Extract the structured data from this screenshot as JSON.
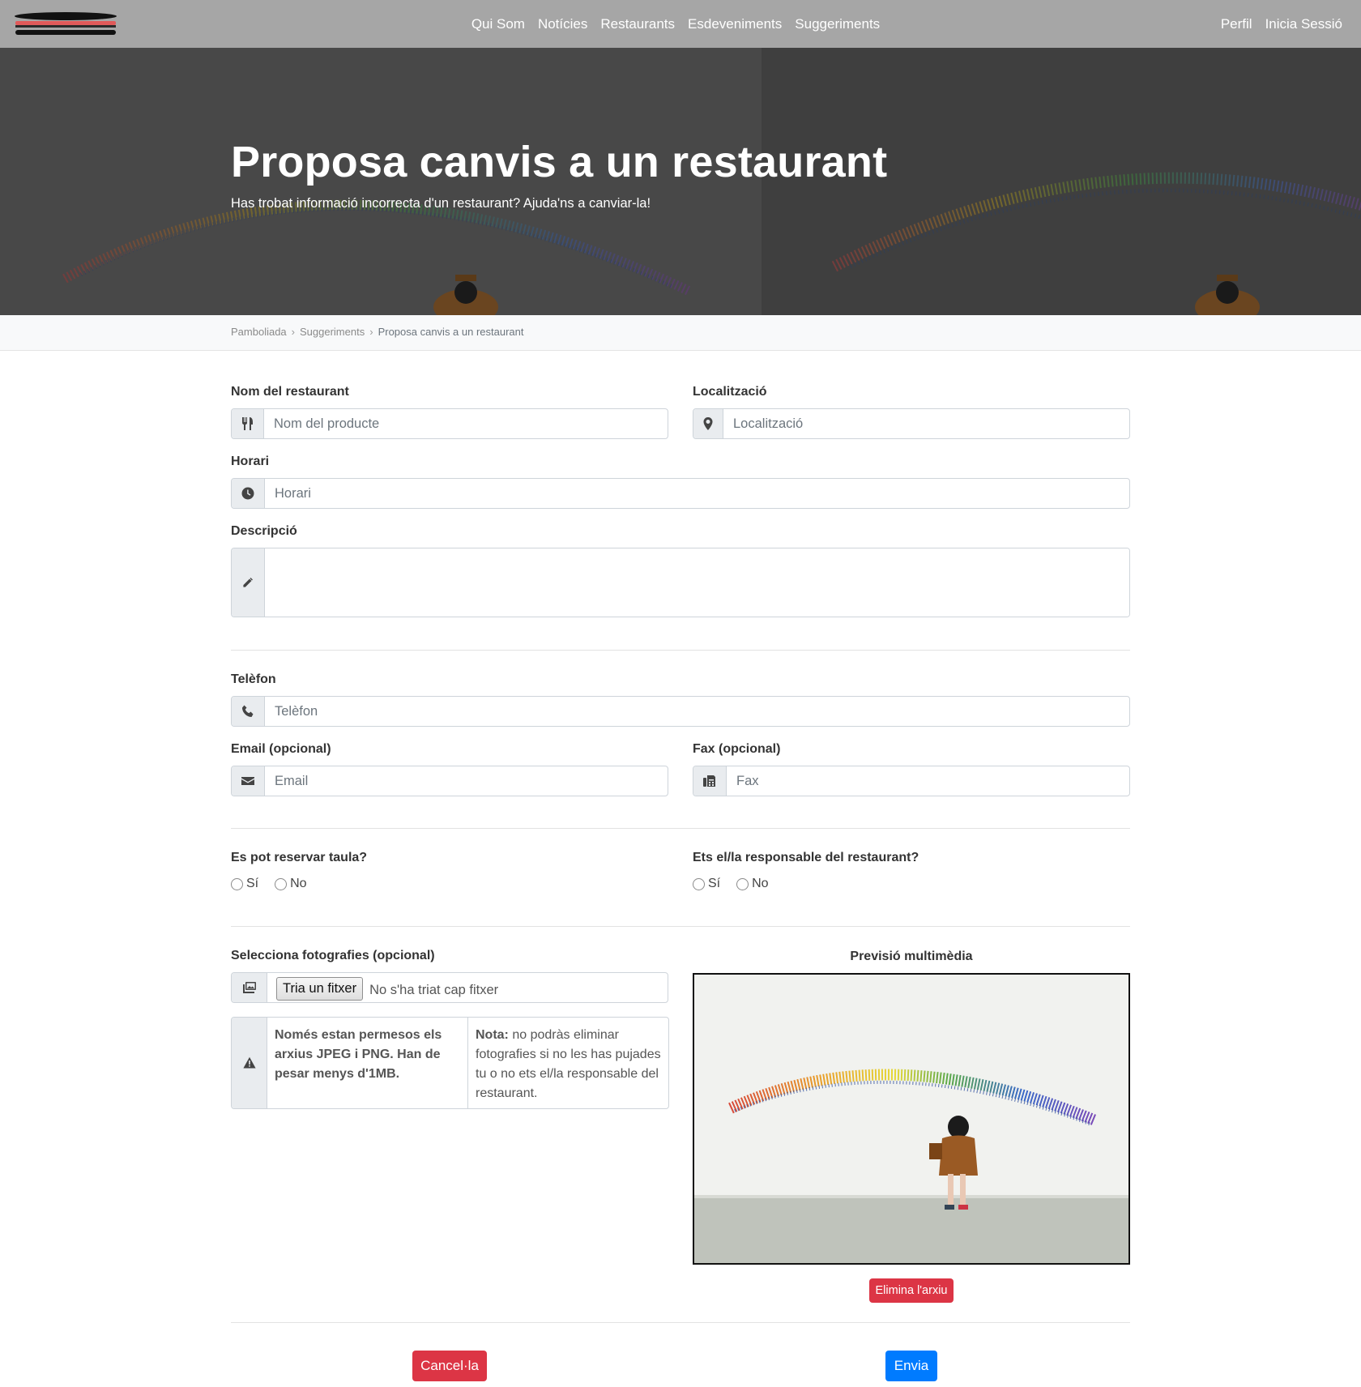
{
  "nav": {
    "links": [
      "Qui Som",
      "Notícies",
      "Restaurants",
      "Esdeveniments",
      "Suggeriments"
    ],
    "profile": "Perfil",
    "login": "Inicia Sessió"
  },
  "hero": {
    "title": "Proposa canvis a un restaurant",
    "subtitle": "Has trobat informació incorrecta d'un restaurant? Ajuda'ns a canviar-la!"
  },
  "breadcrumb": [
    "Pamboliada",
    "Suggeriments",
    "Proposa canvis a un restaurant"
  ],
  "form": {
    "name": {
      "label": "Nom del restaurant",
      "placeholder": "Nom del producte",
      "icon": "utensils-icon"
    },
    "location": {
      "label": "Localització",
      "placeholder": "Localització",
      "icon": "map-marker-icon"
    },
    "hours": {
      "label": "Horari",
      "placeholder": "Horari",
      "icon": "clock-icon"
    },
    "description": {
      "label": "Descripció",
      "value": "",
      "icon": "pencil-icon"
    },
    "phone": {
      "label": "Telèfon",
      "placeholder": "Telèfon",
      "icon": "phone-icon"
    },
    "email": {
      "label": "Email (opcional)",
      "placeholder": "Email",
      "icon": "envelope-icon"
    },
    "fax": {
      "label": "Fax (opcional)",
      "placeholder": "Fax",
      "icon": "fax-icon"
    },
    "reserve": {
      "label": "Es pot reservar taula?",
      "yes": "Sí",
      "no": "No"
    },
    "owner": {
      "label": "Ets el/la responsable del restaurant?",
      "yes": "Sí",
      "no": "No"
    },
    "photos": {
      "label": "Selecciona fotografies (opcional)",
      "button": "Tria un fitxer",
      "none": "No s'ha triat cap fitxer",
      "icon": "images-icon"
    },
    "notes": {
      "formats": "Només estan permesos els arxius JPEG i PNG. Han de pesar menys d'1MB.",
      "nota_label": "Nota:",
      "nota_text": " no podràs eliminar fotografies si no les has pujades tu o no ets el/la responsable del restaurant.",
      "icon": "warning-icon"
    },
    "preview": {
      "title": "Previsió multimèdia",
      "delete": "Elimina l'arxiu"
    },
    "cancel": "Cancel·la",
    "submit": "Envia"
  },
  "colors": {
    "navbar": "#a6a6a6",
    "danger": "#dc3545",
    "primary": "#007bff"
  }
}
